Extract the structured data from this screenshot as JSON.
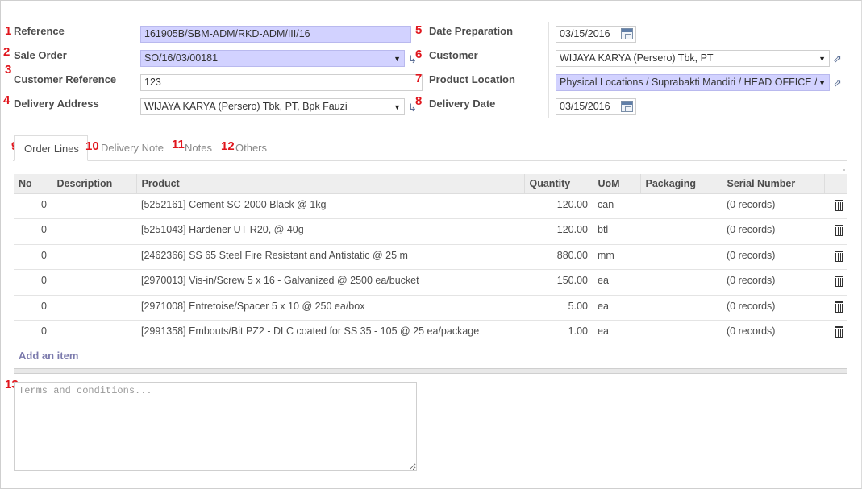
{
  "markers": [
    "1",
    "2",
    "3",
    "4",
    "5",
    "6",
    "7",
    "8",
    "9",
    "10",
    "11",
    "12",
    "13"
  ],
  "form": {
    "reference": {
      "label": "Reference",
      "value": "161905B/SBM-ADM/RKD-ADM/III/16"
    },
    "sale_order": {
      "label": "Sale Order",
      "value": "SO/16/03/00181"
    },
    "customer_reference": {
      "label": "Customer Reference",
      "value": "123"
    },
    "delivery_address": {
      "label": "Delivery Address",
      "value": "WIJAYA KARYA (Persero) Tbk, PT, Bpk Fauzi"
    },
    "date_preparation": {
      "label": "Date Preparation",
      "value": "03/15/2016"
    },
    "customer": {
      "label": "Customer",
      "value": "WIJAYA KARYA (Persero) Tbk, PT"
    },
    "product_location": {
      "label": "Product Location",
      "value": "Physical Locations / Suprabakti Mandiri / HEAD OFFICE /"
    },
    "delivery_date": {
      "label": "Delivery Date",
      "value": "03/15/2016"
    }
  },
  "tabs": [
    {
      "label": "Order Lines"
    },
    {
      "label": "Delivery Note"
    },
    {
      "label": "Notes"
    },
    {
      "label": "Others"
    }
  ],
  "table": {
    "headers": [
      "No",
      "Description",
      "Product",
      "Quantity",
      "UoM",
      "Packaging",
      "Serial Number",
      ""
    ],
    "rows": [
      {
        "no": "0",
        "description": "",
        "product": "[5252161] Cement SC-2000 Black @ 1kg",
        "quantity": "120.00",
        "uom": "can",
        "packaging": "",
        "serial": "(0 records)"
      },
      {
        "no": "0",
        "description": "",
        "product": "[5251043] Hardener UT-R20, @ 40g",
        "quantity": "120.00",
        "uom": "btl",
        "packaging": "",
        "serial": "(0 records)"
      },
      {
        "no": "0",
        "description": "",
        "product": "[2462366] SS 65 Steel Fire Resistant and Antistatic @ 25 m",
        "quantity": "880.00",
        "uom": "mm",
        "packaging": "",
        "serial": "(0 records)"
      },
      {
        "no": "0",
        "description": "",
        "product": "[2970013] Vis-in/Screw 5 x 16 - Galvanized @ 2500 ea/bucket",
        "quantity": "150.00",
        "uom": "ea",
        "packaging": "",
        "serial": "(0 records)"
      },
      {
        "no": "0",
        "description": "",
        "product": "[2971008] Entretoise/Spacer 5 x 10 @ 250 ea/box",
        "quantity": "5.00",
        "uom": "ea",
        "packaging": "",
        "serial": "(0 records)"
      },
      {
        "no": "0",
        "description": "",
        "product": "[2991358] Embouts/Bit PZ2 - DLC coated for SS 35 - 105 @ 25 ea/package",
        "quantity": "1.00",
        "uom": "ea",
        "packaging": "",
        "serial": "(0 records)"
      }
    ],
    "add_item": "Add an item"
  },
  "terms": {
    "placeholder": "Terms and conditions..."
  },
  "colors": {
    "required_field": "#d2d2ff",
    "marker": "#e0161d",
    "link": "#7c7bad"
  },
  "icons": {
    "select": "chevron-down-icon",
    "calendar": "calendar-icon",
    "external": "external-link-icon",
    "delete": "trash-icon"
  }
}
